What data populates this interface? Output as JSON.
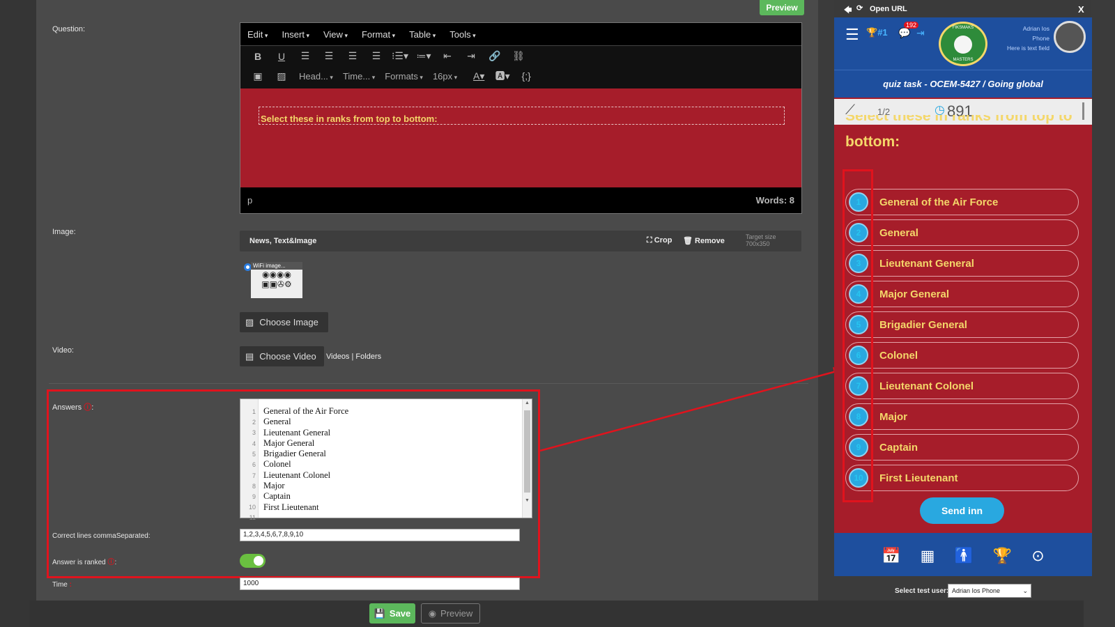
{
  "editor": {
    "preview_top": "Preview",
    "question_label": "Question:",
    "menu": [
      "Edit",
      "Insert",
      "View",
      "Format",
      "Table",
      "Tools"
    ],
    "toolbar_dropdowns": {
      "heading": "Head...",
      "font": "Time...",
      "formats": "Formats",
      "size": "16px"
    },
    "content": "Select these in ranks from top to bottom:",
    "status_path": "p",
    "word_count": "Words: 8"
  },
  "image": {
    "label": "Image:",
    "bar_title": "News, Text&Image",
    "crop": "Crop",
    "remove": "Remove",
    "target_size_label": "Target size",
    "target_size_value": "700x350",
    "thumb_caption": "WiFi image...",
    "choose_image": "Choose Image"
  },
  "video": {
    "label": "Video:",
    "choose_video": "Choose Video",
    "videos_link": "Videos",
    "folders_link": "Folders"
  },
  "answers": {
    "label": "Answers",
    "lines": [
      "General of the Air Force",
      "General",
      "Lieutenant General",
      "Major General",
      "Brigadier General",
      "Colonel",
      "Lieutenant Colonel",
      "Major",
      "Captain",
      "First Lieutenant"
    ],
    "correct_label": "Correct lines commaSeparated:",
    "correct_value": "1,2,3,4,5,6,7,8,9,10",
    "ranked_label": "Answer is ranked",
    "ranked": true
  },
  "time": {
    "label": "Time",
    "value": "1000"
  },
  "footer": {
    "save": "Save",
    "preview": "Preview"
  },
  "phone": {
    "open_url": "Open URL",
    "close": "X",
    "rank": "#1",
    "badge": "192",
    "user_name": "Adrian Ios",
    "user_line2": "Phone",
    "user_line3": "Here is text field",
    "logo_top": "FIKSMAKS",
    "logo_bottom": "MASTERS",
    "task_title": "quiz task - OCEM-5427 / Going global",
    "progress": "1/2",
    "timer": "891",
    "question_partial": "Select these in ranks from top to",
    "question_last": "bottom:",
    "answers": [
      "General of the Air Force",
      "General",
      "Lieutenant General",
      "Major General",
      "Brigadier General",
      "Colonel",
      "Lieutenant Colonel",
      "Major",
      "Captain",
      "First Lieutenant"
    ],
    "send": "Send inn",
    "test_user_label": "Select test user:",
    "test_user_value": "Adrian Ios Phone"
  }
}
